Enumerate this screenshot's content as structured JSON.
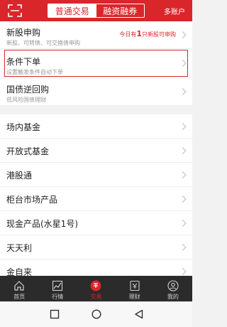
{
  "header": {
    "tabs": [
      {
        "label": "普通交易",
        "active": true
      },
      {
        "label": "融资融券",
        "active": false
      }
    ],
    "multi_account": "多账户"
  },
  "list": [
    {
      "title": "新股申购",
      "subtitle": "新股、可转债、可交换债申购",
      "hint": {
        "prefix": "今日有",
        "count": "1",
        "suffix": "只新股可申购"
      }
    },
    {
      "title": "条件下单",
      "subtitle": "设置触发条件自动下单",
      "highlighted": true
    },
    {
      "title": "国债逆回购",
      "subtitle": "低风险国债理财"
    },
    {
      "title": "场内基金"
    },
    {
      "title": "开放式基金"
    },
    {
      "title": "港股通"
    },
    {
      "title": "柜台市场产品"
    },
    {
      "title": "现金产品(水星1号)"
    },
    {
      "title": "天天利"
    },
    {
      "title": "金自来"
    }
  ],
  "tabbar": [
    {
      "label": "首页",
      "icon": "home-icon"
    },
    {
      "label": "行情",
      "icon": "chart-icon"
    },
    {
      "label": "交易",
      "icon": "trade-icon",
      "active": true
    },
    {
      "label": "理财",
      "icon": "finance-icon"
    },
    {
      "label": "我的",
      "icon": "user-icon"
    }
  ],
  "colors": {
    "accent": "#d9262b",
    "tabbar_bg": "#2b2b2b"
  }
}
